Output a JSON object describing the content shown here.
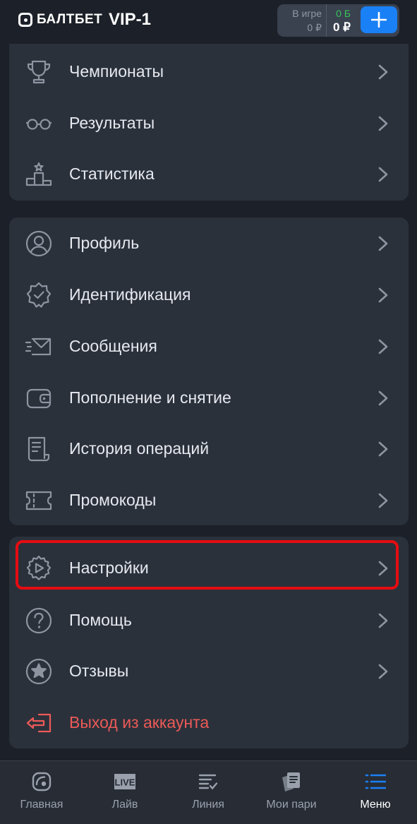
{
  "header": {
    "brand": "БАЛТБЕТ",
    "level": "VIP-1",
    "in_game_label": "В игре",
    "in_game_value": "0 ₽",
    "bonus_value": "0 Б",
    "balance_value": "0 ₽"
  },
  "menu_groups": [
    [
      {
        "label": "Чемпионаты",
        "icon": "trophy-icon"
      },
      {
        "label": "Результаты",
        "icon": "glasses-icon"
      },
      {
        "label": "Статистика",
        "icon": "podium-icon"
      }
    ],
    [
      {
        "label": "Профиль",
        "icon": "user-icon"
      },
      {
        "label": "Идентификация",
        "icon": "verified-badge-icon"
      },
      {
        "label": "Сообщения",
        "icon": "envelope-icon"
      },
      {
        "label": "Пополнение и снятие",
        "icon": "wallet-icon"
      },
      {
        "label": "История операций",
        "icon": "receipt-icon"
      },
      {
        "label": "Промокоды",
        "icon": "ticket-icon"
      }
    ],
    [
      {
        "label": "Настройки",
        "icon": "gear-icon"
      },
      {
        "label": "Помощь",
        "icon": "help-icon"
      },
      {
        "label": "Отзывы",
        "icon": "star-icon"
      },
      {
        "label": "Выход из аккаунта",
        "icon": "logout-icon"
      }
    ]
  ],
  "tabbar": [
    {
      "label": "Главная",
      "icon": "home-icon"
    },
    {
      "label": "Лайв",
      "icon": "live-icon"
    },
    {
      "label": "Линия",
      "icon": "line-list-icon"
    },
    {
      "label": "Мои пари",
      "icon": "my-bets-icon"
    },
    {
      "label": "Меню",
      "icon": "menu-icon"
    }
  ],
  "colors": {
    "accent": "#1a80f5",
    "bonus": "#38c25a",
    "danger": "#ec5a57",
    "highlight": "#e50c12",
    "card": "#2b313b",
    "background": "#1c2028"
  }
}
